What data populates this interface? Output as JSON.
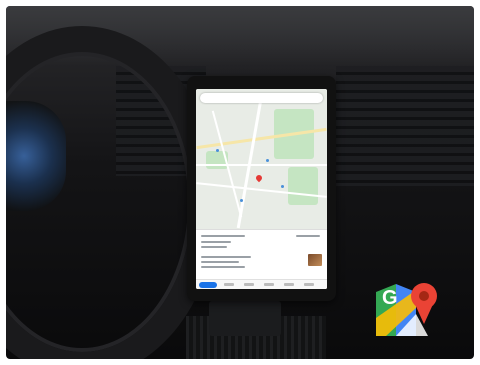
{
  "scene": {
    "description_tag": "car-dashboard-tablet-mount",
    "logo": {
      "icon": "google-maps-logo-icon",
      "letter": "G",
      "colors": [
        "#34A853",
        "#4285F4",
        "#FBBC04",
        "#EA4335"
      ]
    }
  },
  "tablet": {
    "app_icon": "map-icon",
    "pin_color": "#E53935",
    "accent": "#1A73E8"
  }
}
